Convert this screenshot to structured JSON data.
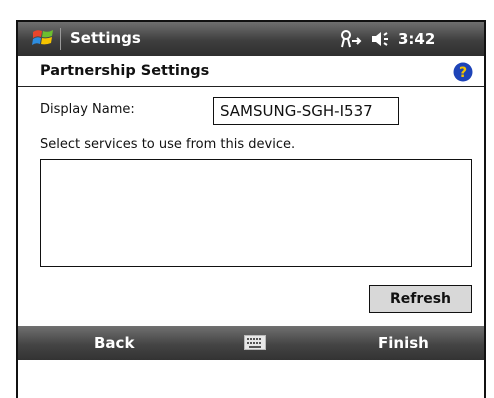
{
  "titlebar": {
    "app_icon": "windows-flag-icon",
    "title": "Settings",
    "status_icons": [
      "connectivity-icon",
      "speaker-icon"
    ],
    "time": "3:42"
  },
  "header": {
    "title": "Partnership Settings",
    "help_icon": "help-icon"
  },
  "form": {
    "display_name_label": "Display Name:",
    "display_name_value": "SAMSUNG-SGH-I537",
    "services_label": "Select services to use from this device.",
    "services_list": []
  },
  "buttons": {
    "refresh": "Refresh"
  },
  "softkeys": {
    "left": "Back",
    "center_icon": "keyboard-icon",
    "right": "Finish"
  },
  "colors": {
    "bar_dark": "#3e3e3e",
    "help_blue": "#1e44b8",
    "help_glyph": "#f5c400"
  }
}
